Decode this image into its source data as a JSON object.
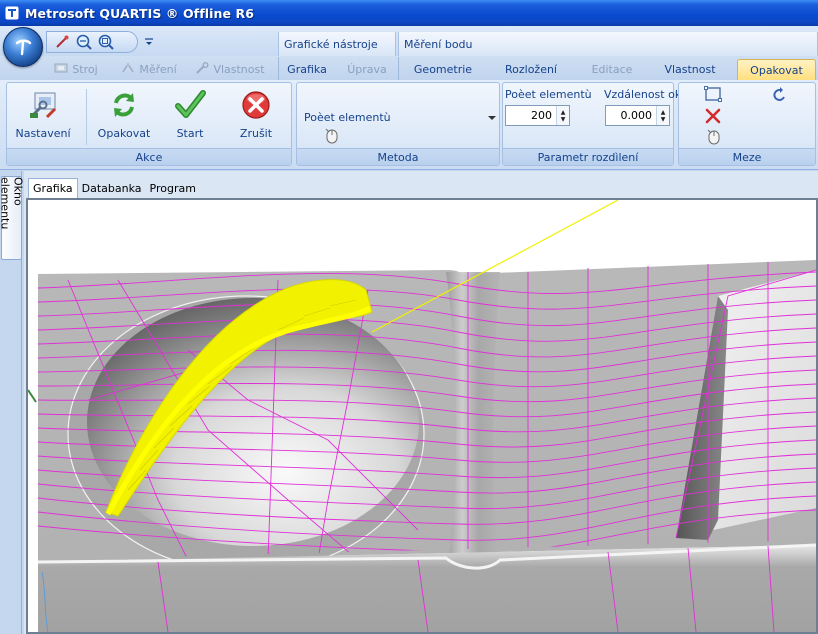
{
  "window": {
    "title": "Metrosoft QUARTIS ® Offline R6"
  },
  "quick_access": {
    "icons": [
      "app-orb-icon",
      "probe-icon",
      "zoom-icon",
      "zoom-fit-icon",
      "dropdown-arrow-icon"
    ]
  },
  "context_groups": {
    "graficke": "Grafické nástroje",
    "mereni": "Měření bodu"
  },
  "tabs": [
    {
      "label": "Stroj",
      "enabled": false
    },
    {
      "label": "Měření",
      "enabled": false
    },
    {
      "label": "Vlastnost",
      "enabled": false
    },
    {
      "label": "Grafika",
      "enabled": true
    },
    {
      "label": "Úprava",
      "enabled": false
    },
    {
      "label": "Geometrie",
      "enabled": true
    },
    {
      "label": "Rozložení",
      "enabled": true
    },
    {
      "label": "Editace",
      "enabled": false
    },
    {
      "label": "Vlastnost",
      "enabled": true
    },
    {
      "label": "Opakovat",
      "enabled": true,
      "active": true
    }
  ],
  "ribbon": {
    "akce": {
      "label": "Akce",
      "buttons": [
        {
          "label": "Nastavení",
          "icon": "settings-tools-icon"
        },
        {
          "label": "Opakovat",
          "icon": "repeat-arrows-icon"
        },
        {
          "label": "Start",
          "icon": "checkmark-icon"
        },
        {
          "label": "Zrušit",
          "icon": "cancel-x-icon"
        }
      ]
    },
    "metoda": {
      "label": "Metoda",
      "dropdown_value": "Poèet elementù",
      "icon": "mouse-icon"
    },
    "parametr": {
      "label": "Parametr rozdìlení",
      "count_label": "Poèet elementù",
      "count_value": "200",
      "distance_label": "Vzdálenost ok",
      "distance_value": "0.000"
    },
    "meze": {
      "label": "Meze",
      "icons": [
        "boundary-rect-icon",
        "undo-curve-icon",
        "delete-x-icon",
        "mouse-icon"
      ]
    }
  },
  "side_panel": {
    "tab_label": "Okno elementu"
  },
  "document_tabs": [
    {
      "label": "Grafika",
      "active": true
    },
    {
      "label": "Databanka",
      "active": false
    },
    {
      "label": "Program",
      "active": false
    }
  ],
  "colors": {
    "title_bar": "#0a4bd0",
    "active_tab": "#ffdf7e",
    "mesh_lines": "#e030d8",
    "highlight_elements": "#ffff1e",
    "surface": "#b4b4b4"
  }
}
